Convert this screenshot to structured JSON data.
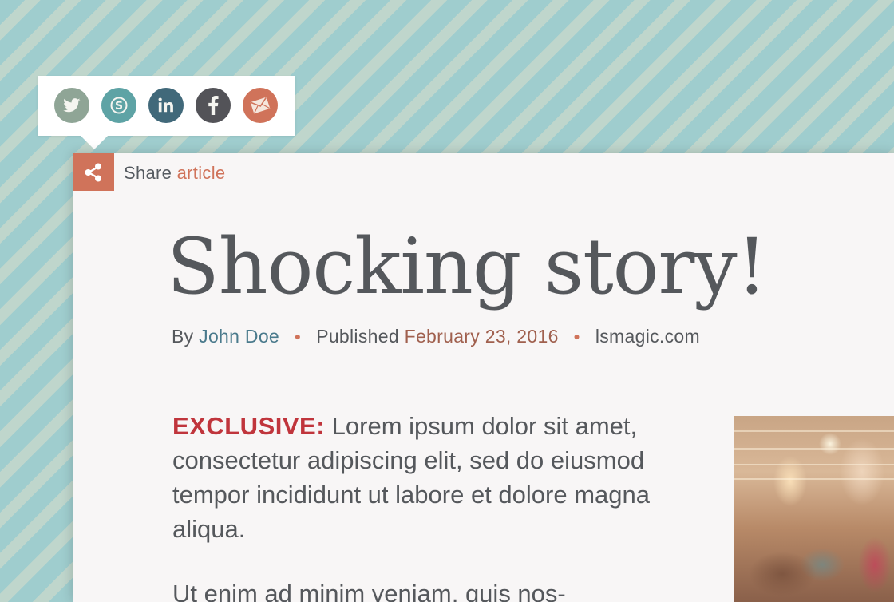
{
  "share_popup": {
    "buttons": [
      {
        "name": "twitter",
        "icon": "twitter-icon",
        "color": "#8fa596"
      },
      {
        "name": "skype",
        "icon": "skype-icon",
        "color": "#5ea3a5"
      },
      {
        "name": "linkedin",
        "icon": "linkedin-icon",
        "color": "#41697a"
      },
      {
        "name": "facebook",
        "icon": "facebook-icon",
        "color": "#535358"
      },
      {
        "name": "email",
        "icon": "email-icon",
        "color": "#d0735a"
      }
    ]
  },
  "share_bar": {
    "icon": "share-icon",
    "label_prefix": "Share",
    "label_accent": "article"
  },
  "article": {
    "headline": "Shocking story!",
    "byline": {
      "by": "By",
      "author": "John Doe",
      "published": "Published",
      "date": "February 23, 2016",
      "site": "lsmagic.com"
    },
    "kicker": "EXCLUSIVE:",
    "lead_text": "Lorem ipsum dolor sit amet, consectetur adipiscing elit, sed do eiusmod tempor incididunt ut labore et dolore magna aliqua.",
    "para2": "Ut enim ad minim veniam, quis nos-"
  },
  "colors": {
    "accent": "#d0735a",
    "kicker": "#c0353c",
    "text": "#55585c",
    "author_link": "#4a7a8c",
    "card_bg": "#f8f6f6"
  }
}
